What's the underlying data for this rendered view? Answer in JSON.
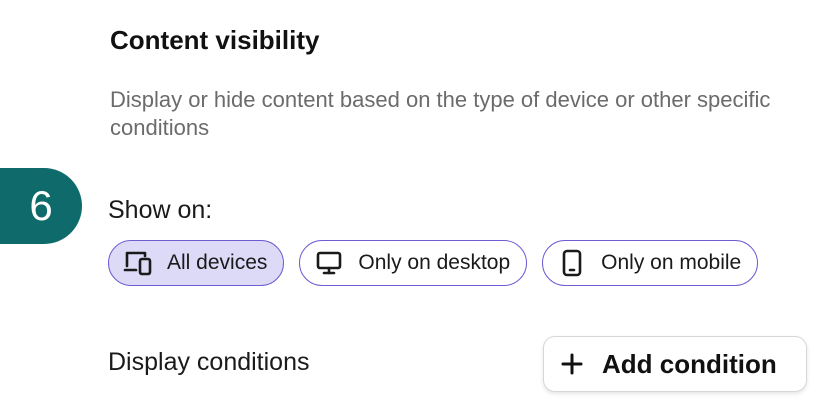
{
  "section": {
    "title": "Content visibility",
    "description": "Display or hide content based on the type of device or other specific conditions"
  },
  "step": {
    "number": "6",
    "color": "#0f6b6b"
  },
  "show_on": {
    "label": "Show on:",
    "options": [
      {
        "label": "All devices",
        "icon": "devices-icon",
        "selected": true
      },
      {
        "label": "Only on desktop",
        "icon": "desktop-icon",
        "selected": false
      },
      {
        "label": "Only on mobile",
        "icon": "mobile-icon",
        "selected": false
      }
    ],
    "accent_color": "#6c5dd3",
    "selected_bg": "#dcdaf7"
  },
  "display_conditions": {
    "label": "Display conditions",
    "add_button_label": "Add condition",
    "add_button_icon": "plus-icon"
  }
}
